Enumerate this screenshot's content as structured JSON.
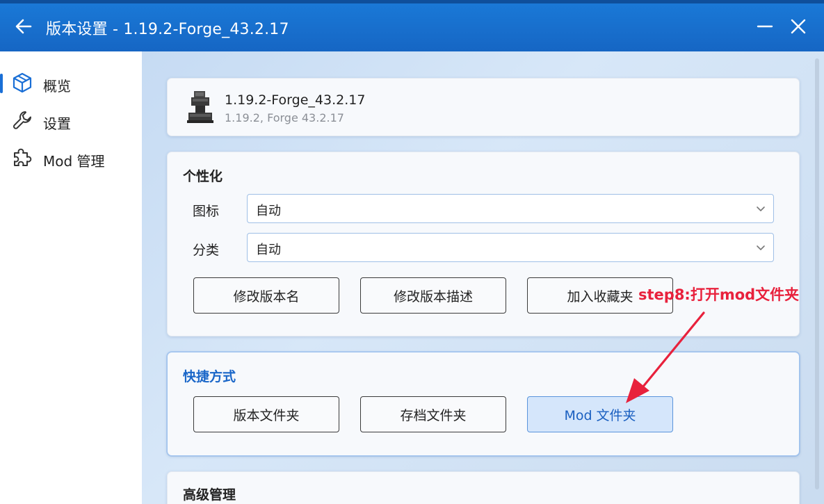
{
  "window": {
    "title": "版本设置 - 1.19.2-Forge_43.2.17"
  },
  "sidebar": {
    "items": [
      {
        "label": "概览",
        "icon": "cube-icon",
        "selected": true
      },
      {
        "label": "设置",
        "icon": "wrench-icon",
        "selected": false
      },
      {
        "label": "Mod 管理",
        "icon": "puzzle-icon",
        "selected": false
      }
    ]
  },
  "version": {
    "name": "1.19.2-Forge_43.2.17",
    "subtitle": "1.19.2, Forge 43.2.17",
    "icon": "anvil-icon"
  },
  "personalize": {
    "title": "个性化",
    "icon_label": "图标",
    "icon_value": "自动",
    "category_label": "分类",
    "category_value": "自动",
    "buttons": [
      "修改版本名",
      "修改版本描述",
      "加入收藏夹"
    ]
  },
  "shortcuts": {
    "title": "快捷方式",
    "buttons": [
      "版本文件夹",
      "存档文件夹",
      "Mod 文件夹"
    ]
  },
  "advanced": {
    "title": "高级管理"
  },
  "annotation": {
    "text": "step8:打开mod文件夹",
    "color": "#e8213c"
  },
  "colors": {
    "titlebar": "#1a74d2",
    "accent": "#1a6fd6",
    "annotation": "#e8213c"
  }
}
